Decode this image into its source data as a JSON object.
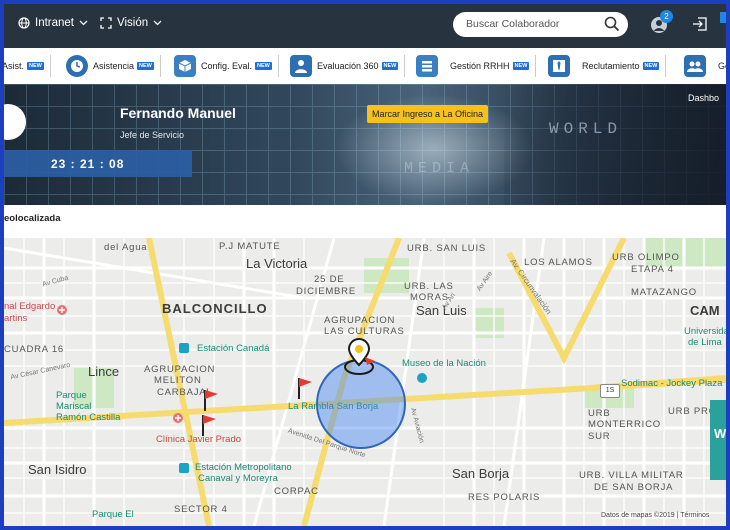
{
  "topbar": {
    "intranet_label": "Intranet",
    "vision_label": "Visión",
    "search_placeholder": "Buscar Colaborador",
    "notifications_count": "2"
  },
  "modules": [
    {
      "label": "Asist.",
      "badge": "NEW",
      "icon": "calendar-icon"
    },
    {
      "label": "Asistencia",
      "badge": "NEW",
      "icon": "clock-icon"
    },
    {
      "label": "Config. Eval.",
      "badge": "NEW",
      "icon": "box-icon"
    },
    {
      "label": "Evaluación 360",
      "badge": "NEW",
      "icon": "person-icon"
    },
    {
      "label": "Gestión RRHH",
      "badge": "NEW",
      "icon": "stack-icon"
    },
    {
      "label": "Reclutamiento",
      "badge": "NEW",
      "icon": "tie-icon"
    },
    {
      "label": "Ge",
      "badge": "",
      "icon": "people-icon"
    }
  ],
  "hero": {
    "name": "Fernando Manuel",
    "role": "Jefe de Servicio",
    "clock": "23 : 21 : 08",
    "mark_button": "Marcar Ingreso a La Oficina",
    "dashboard_link": "Dashbo",
    "bg_word_world": "WORLD",
    "bg_word_media": "MEDIA"
  },
  "section_title": "eolocalizada",
  "map": {
    "districts": [
      "La Victoria",
      "BALCONCILLO",
      "San Luis",
      "Lince",
      "San Isidro",
      "San Borja",
      "CAM"
    ],
    "neighborhoods": [
      "P.J MATUTE",
      "URB. SAN LUIS",
      "URB OLIMPO",
      "25 DE",
      "DICIEMBRE",
      "URB. LAS",
      "MORAS",
      "LOS ALAMOS",
      "ETAPA 4",
      "MATAZANGO",
      "AGRUPACION",
      "LAS CULTURAS",
      "AGRUPACION",
      "MELITON",
      "CARBAJAL",
      "URB",
      "MONTERRICO",
      "SUR",
      "RES POLARIS",
      "SECTOR 4",
      "CORPAC",
      "URB. VILLA MILITAR",
      "DE SAN BORJA",
      "CUADRA 16",
      "URB PRO"
    ],
    "pois": [
      "Museo de la Nación",
      "Estación Canadá",
      "La Rambla San Borja",
      "Estación Metropolitano",
      "Canaval y Moreyra",
      "Sodimac - Jockey Plaza",
      "Parque",
      "Mariscal",
      "Ramón Castilla",
      "Universidad",
      "de Lima",
      "Parque El"
    ],
    "red_pois": [
      "nal Edgardo",
      "artins",
      "Clínica Javier Prado"
    ],
    "streets": [
      "Av Cuba",
      "Av César Canevaro",
      "Av. Circunvalación",
      "Av Aire",
      "Avenida Del Parque Norte",
      "Av Aviación",
      "Av Ari",
      "del Agua"
    ],
    "highway": "1S",
    "footer": "Datos de mapas ©2019 | Términos",
    "side_letter": "W"
  },
  "colors": {
    "topbar": "#27343f",
    "accent_blue": "#1e6fd6",
    "mark_button": "#f4c21b",
    "geofence": "#4285f4"
  }
}
